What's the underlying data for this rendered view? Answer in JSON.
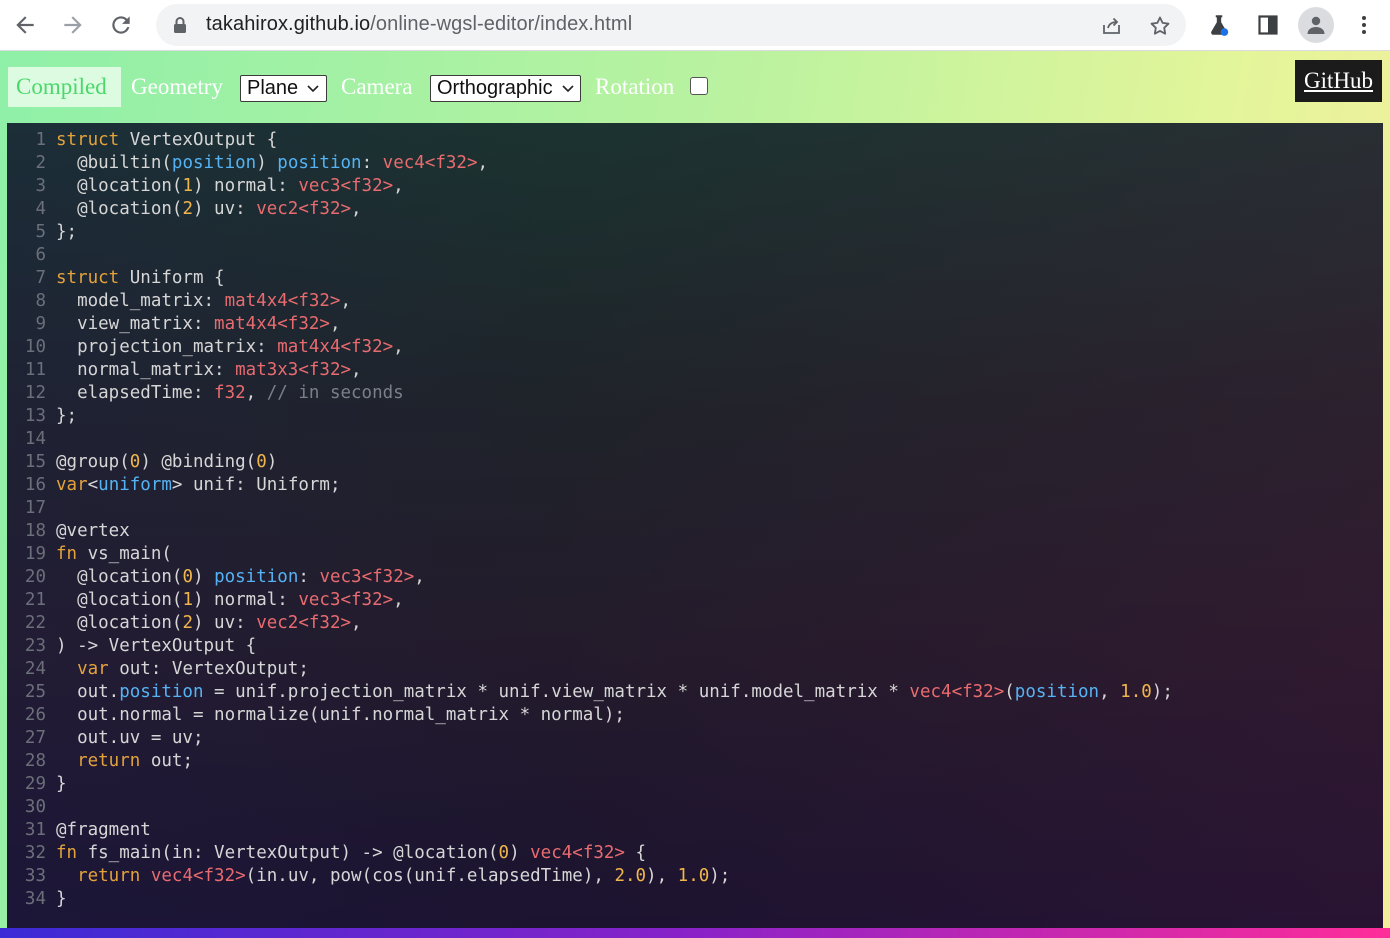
{
  "browser": {
    "url_host": "takahirox.github.io",
    "url_path": "/online-wgsl-editor/index.html"
  },
  "toolbar": {
    "compiled_label": "Compiled",
    "geometry_label": "Geometry",
    "geometry_value": "Plane",
    "camera_label": "Camera",
    "camera_value": "Orthographic",
    "rotation_label": "Rotation",
    "rotation_checked": false,
    "github_label": "GitHub"
  },
  "colors": {
    "keyword": "#e3a23b",
    "type": "#e86b6f",
    "builtin": "#55b3f3",
    "number": "#f0b64b",
    "comment": "#7a7f8a",
    "text": "#d6d6d6"
  },
  "editor": {
    "lines": [
      [
        [
          "k",
          "struct"
        ],
        [
          "x",
          " VertexOutput {"
        ]
      ],
      [
        [
          "x",
          "  @builtin("
        ],
        [
          "b",
          "position"
        ],
        [
          "x",
          ") "
        ],
        [
          "b",
          "position"
        ],
        [
          "x",
          ": "
        ],
        [
          "t",
          "vec4<f32>"
        ],
        [
          "x",
          ","
        ]
      ],
      [
        [
          "x",
          "  @location("
        ],
        [
          "n",
          "1"
        ],
        [
          "x",
          ") normal: "
        ],
        [
          "t",
          "vec3<f32>"
        ],
        [
          "x",
          ","
        ]
      ],
      [
        [
          "x",
          "  @location("
        ],
        [
          "n",
          "2"
        ],
        [
          "x",
          ") uv: "
        ],
        [
          "t",
          "vec2<f32>"
        ],
        [
          "x",
          ","
        ]
      ],
      [
        [
          "x",
          "};"
        ]
      ],
      [],
      [
        [
          "k",
          "struct"
        ],
        [
          "x",
          " Uniform {"
        ]
      ],
      [
        [
          "x",
          "  model_matrix: "
        ],
        [
          "t",
          "mat4x4<f32>"
        ],
        [
          "x",
          ","
        ]
      ],
      [
        [
          "x",
          "  view_matrix: "
        ],
        [
          "t",
          "mat4x4<f32>"
        ],
        [
          "x",
          ","
        ]
      ],
      [
        [
          "x",
          "  projection_matrix: "
        ],
        [
          "t",
          "mat4x4<f32>"
        ],
        [
          "x",
          ","
        ]
      ],
      [
        [
          "x",
          "  normal_matrix: "
        ],
        [
          "t",
          "mat3x3<f32>"
        ],
        [
          "x",
          ","
        ]
      ],
      [
        [
          "x",
          "  elapsedTime: "
        ],
        [
          "t",
          "f32"
        ],
        [
          "x",
          ", "
        ],
        [
          "c",
          "// in seconds"
        ]
      ],
      [
        [
          "x",
          "};"
        ]
      ],
      [],
      [
        [
          "x",
          "@group("
        ],
        [
          "n",
          "0"
        ],
        [
          "x",
          ") @binding("
        ],
        [
          "n",
          "0"
        ],
        [
          "x",
          ")"
        ]
      ],
      [
        [
          "k",
          "var"
        ],
        [
          "x",
          "<"
        ],
        [
          "b",
          "uniform"
        ],
        [
          "x",
          "> unif: Uniform;"
        ]
      ],
      [],
      [
        [
          "x",
          "@vertex"
        ]
      ],
      [
        [
          "k",
          "fn"
        ],
        [
          "x",
          " vs_main("
        ]
      ],
      [
        [
          "x",
          "  @location("
        ],
        [
          "n",
          "0"
        ],
        [
          "x",
          ") "
        ],
        [
          "b",
          "position"
        ],
        [
          "x",
          ": "
        ],
        [
          "t",
          "vec3<f32>"
        ],
        [
          "x",
          ","
        ]
      ],
      [
        [
          "x",
          "  @location("
        ],
        [
          "n",
          "1"
        ],
        [
          "x",
          ") normal: "
        ],
        [
          "t",
          "vec3<f32>"
        ],
        [
          "x",
          ","
        ]
      ],
      [
        [
          "x",
          "  @location("
        ],
        [
          "n",
          "2"
        ],
        [
          "x",
          ") uv: "
        ],
        [
          "t",
          "vec2<f32>"
        ],
        [
          "x",
          ","
        ]
      ],
      [
        [
          "x",
          ") -> VertexOutput {"
        ]
      ],
      [
        [
          "x",
          "  "
        ],
        [
          "k",
          "var"
        ],
        [
          "x",
          " out: VertexOutput;"
        ]
      ],
      [
        [
          "x",
          "  out."
        ],
        [
          "b",
          "position"
        ],
        [
          "x",
          " = unif.projection_matrix * unif.view_matrix * unif.model_matrix * "
        ],
        [
          "t",
          "vec4<f32>"
        ],
        [
          "x",
          "("
        ],
        [
          "b",
          "position"
        ],
        [
          "x",
          ", "
        ],
        [
          "n",
          "1.0"
        ],
        [
          "x",
          ");"
        ]
      ],
      [
        [
          "x",
          "  out.normal = normalize(unif.normal_matrix * normal);"
        ]
      ],
      [
        [
          "x",
          "  out.uv = uv;"
        ]
      ],
      [
        [
          "x",
          "  "
        ],
        [
          "k",
          "return"
        ],
        [
          "x",
          " out;"
        ]
      ],
      [
        [
          "x",
          "}"
        ]
      ],
      [],
      [
        [
          "x",
          "@fragment"
        ]
      ],
      [
        [
          "k",
          "fn"
        ],
        [
          "x",
          " fs_main(in: VertexOutput) -> @location("
        ],
        [
          "n",
          "0"
        ],
        [
          "x",
          ") "
        ],
        [
          "t",
          "vec4<f32>"
        ],
        [
          "x",
          " {"
        ]
      ],
      [
        [
          "x",
          "  "
        ],
        [
          "k",
          "return"
        ],
        [
          "x",
          " "
        ],
        [
          "t",
          "vec4<f32>"
        ],
        [
          "x",
          "(in.uv, pow(cos(unif.elapsedTime), "
        ],
        [
          "n",
          "2.0"
        ],
        [
          "x",
          "), "
        ],
        [
          "n",
          "1.0"
        ],
        [
          "x",
          ");"
        ]
      ],
      [
        [
          "x",
          "}"
        ]
      ]
    ]
  }
}
